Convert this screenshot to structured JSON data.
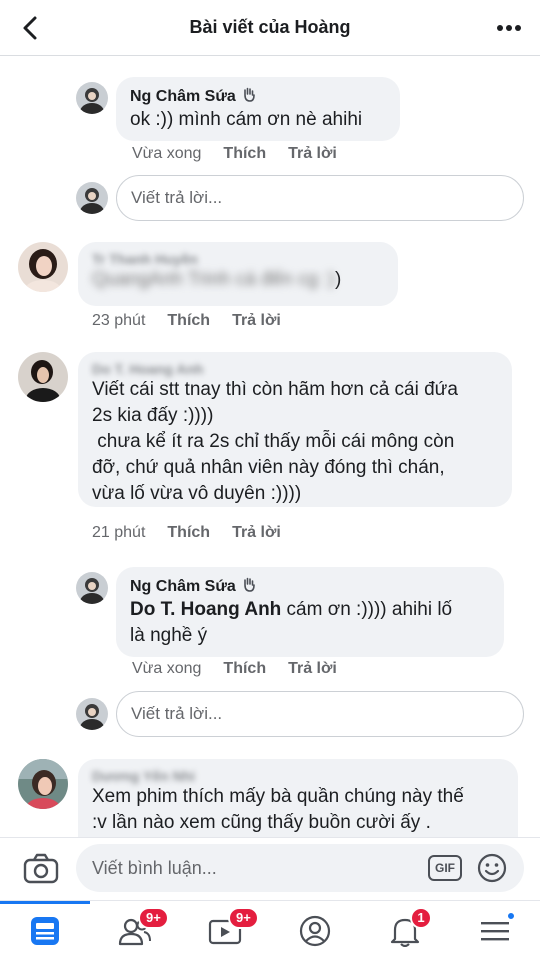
{
  "header": {
    "title": "Bài viết của Hoàng"
  },
  "comments": [
    {
      "name": "Ng Châm Sứa",
      "text": "ok :)) mình cám ơn nè ahihi",
      "time": "Vừa xong",
      "like": "Thích",
      "reply": "Trả lời"
    },
    {
      "name": "Tr Thanh Huyền",
      "text_line1": "QuangAnh Trinh cá đến cg :)",
      "text_tail": ")",
      "time": "23 phút",
      "like": "Thích",
      "reply": "Trả lời"
    },
    {
      "name": "Do T. Hoang Anh",
      "lines": [
        "Viết cái stt tnay thì còn hãm hơn cả cái đứa",
        "2s kia đấy :))))",
        " chưa kể ít ra 2s chỉ thấy mỗi cái mông còn",
        "đỡ, chứ quả nhân viên này đóng thì chán,",
        "vừa lố vừa vô duyên :))))"
      ],
      "time": "21 phút",
      "like": "Thích",
      "reply": "Trả lời"
    },
    {
      "name": "Ng Châm Sứa",
      "mention": "Do T. Hoang Anh",
      "text_after": " cám ơn :)))) ahihi lố",
      "line2": "là nghề ý",
      "time": "Vừa xong",
      "like": "Thích",
      "reply": "Trả lời"
    },
    {
      "name": "Dương Yến Nhi",
      "lines": [
        "Xem phim thích mấy bà quần chúng này thế",
        ":v lần nào xem cũng thấy buồn cười ấy ."
      ]
    }
  ],
  "reply_placeholder": "Viết trả lời...",
  "comment_bar": {
    "placeholder": "Viết bình luận...",
    "gif_label": "GIF"
  },
  "nav": {
    "friends_badge": "9+",
    "watch_badge": "9+",
    "notifications_badge": "1"
  },
  "colors": {
    "accent": "#1877f2",
    "badge": "#e41e3f",
    "bubble": "#f0f2f5"
  }
}
